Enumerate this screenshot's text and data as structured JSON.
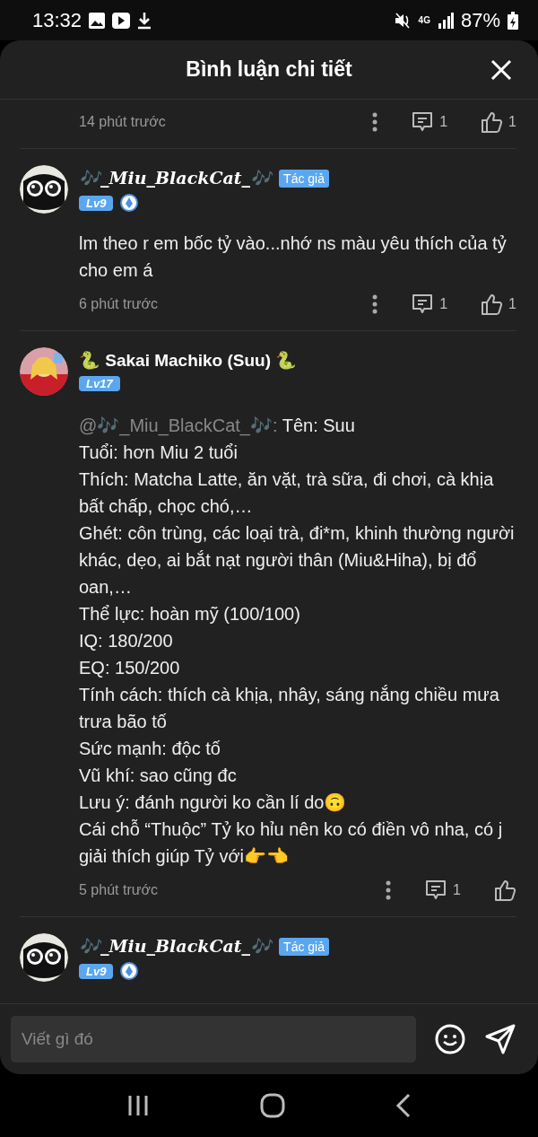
{
  "status_bar": {
    "time": "13:32",
    "battery": "87%",
    "network": "4G"
  },
  "sheet": {
    "title": "Bình luận chi tiết"
  },
  "comments": [
    {
      "time": "14 phút trước",
      "replies": "1",
      "likes": "1"
    },
    {
      "avatar": {
        "kind": "cat"
      },
      "author": "🎶_Miu_BlackCat_🎶",
      "author_tag": "Tác giả",
      "level": "Lv9",
      "verified": true,
      "body": "lm theo r em bốc tỷ vào...nhớ ns màu yêu thích của tỷ cho em á",
      "time": "6 phút trước",
      "replies": "1",
      "likes": "1"
    },
    {
      "author": "🐍 Sakai Machiko (Suu) 🐍",
      "level": "Lv17",
      "mention": "@🎶_Miu_BlackCat_🎶:",
      "body": " Tên: Suu\nTuổi: hơn Miu 2 tuổi\nThích: Matcha Latte, ăn vặt, trà sữa, đi chơi, cà khịa bất chấp, chọc chó,…\nGhét: côn trùng, các loại trà, đi*m, khinh thường người khác, dẹo, ai bắt nạt người thân (Miu&Hiha), bị đổ oan,…\nThể lực: hoàn mỹ (100/100)\nIQ: 180/200\nEQ: 150/200\nTính cách: thích cà khịa, nhây, sáng nắng chiều mưa trưa bão tố\nSức mạnh: độc tố\nVũ khí: sao cũng đc\nLưu ý: đánh người ko cần lí do🙃\nCái chỗ “Thuộc” Tỷ ko hỉu nên ko có điền vô nha, có j giải thích giúp Tỷ với👉👈",
      "time": "5 phút trước",
      "replies": "1"
    },
    {
      "avatar": {
        "kind": "cat"
      },
      "author": "🎶_Miu_BlackCat_🎶",
      "author_tag": "Tác giả",
      "level": "Lv9",
      "verified": true
    }
  ],
  "composer": {
    "placeholder": "Viết gì đó"
  }
}
